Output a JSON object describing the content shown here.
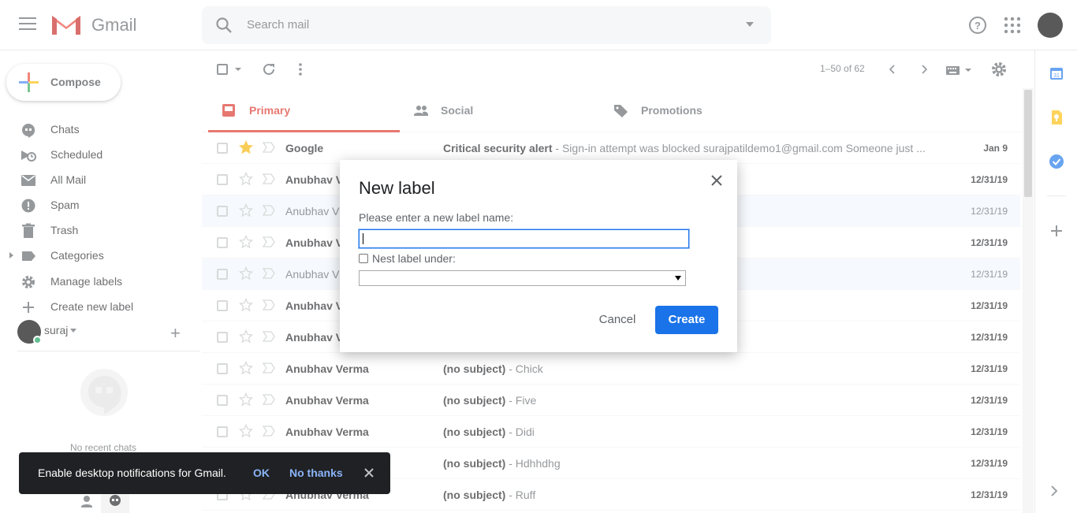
{
  "app": {
    "name": "Gmail"
  },
  "search": {
    "placeholder": "Search mail"
  },
  "compose": {
    "label": "Compose"
  },
  "nav": [
    {
      "label": "Chats",
      "icon": "chat-icon"
    },
    {
      "label": "Scheduled",
      "icon": "scheduled-icon"
    },
    {
      "label": "All Mail",
      "icon": "all-mail-icon"
    },
    {
      "label": "Spam",
      "icon": "spam-icon"
    },
    {
      "label": "Trash",
      "icon": "trash-icon"
    },
    {
      "label": "Categories",
      "icon": "label-icon"
    },
    {
      "label": "Manage labels",
      "icon": "gear-icon"
    },
    {
      "label": "Create new label",
      "icon": "plus-icon"
    }
  ],
  "hangouts": {
    "user": "suraj",
    "empty_text": "No recent chats"
  },
  "toolbar": {
    "range": "1–50 of 62"
  },
  "tabs": [
    {
      "label": "Primary",
      "active": true
    },
    {
      "label": "Social",
      "active": false
    },
    {
      "label": "Promotions",
      "active": false
    }
  ],
  "emails": [
    {
      "sender": "Google",
      "subject": "Critical security alert",
      "snippet": " - Sign-in attempt was blocked surajpatildemo1@gmail.com Someone just ...",
      "date": "Jan 9",
      "unread": true,
      "starred": true
    },
    {
      "sender": "Anubhav V",
      "subject": "",
      "snippet": "",
      "date": "12/31/19",
      "unread": true,
      "starred": false
    },
    {
      "sender": "Anubhav V",
      "subject": "",
      "snippet": "",
      "date": "12/31/19",
      "unread": false,
      "starred": false
    },
    {
      "sender": "Anubhav V",
      "subject": "",
      "snippet": "",
      "date": "12/31/19",
      "unread": true,
      "starred": false
    },
    {
      "sender": "Anubhav V",
      "subject": "",
      "snippet": "",
      "date": "12/31/19",
      "unread": false,
      "starred": false
    },
    {
      "sender": "Anubhav V",
      "subject": "",
      "snippet": "",
      "date": "12/31/19",
      "unread": true,
      "starred": false
    },
    {
      "sender": "Anubhav V",
      "subject": "",
      "snippet": "",
      "date": "12/31/19",
      "unread": true,
      "starred": false
    },
    {
      "sender": "Anubhav Verma",
      "subject": "(no subject)",
      "snippet": " - Chick",
      "date": "12/31/19",
      "unread": true,
      "starred": false
    },
    {
      "sender": "Anubhav Verma",
      "subject": "(no subject)",
      "snippet": " - Five",
      "date": "12/31/19",
      "unread": true,
      "starred": false
    },
    {
      "sender": "Anubhav Verma",
      "subject": "(no subject)",
      "snippet": " - Didi",
      "date": "12/31/19",
      "unread": true,
      "starred": false
    },
    {
      "sender": "Anubhav Verma",
      "subject": "(no subject)",
      "snippet": " - Hdhhdhg",
      "date": "12/31/19",
      "unread": true,
      "starred": false
    },
    {
      "sender": "Anubhav Verma",
      "subject": "(no subject)",
      "snippet": " - Ruff",
      "date": "12/31/19",
      "unread": true,
      "starred": false
    }
  ],
  "dialog": {
    "title": "New label",
    "prompt": "Please enter a new label name:",
    "input_value": "",
    "nest_label": "Nest label under:",
    "nest_checked": false,
    "nest_selected": "",
    "cancel": "Cancel",
    "create": "Create"
  },
  "snackbar": {
    "text": "Enable desktop notifications for Gmail.",
    "ok": "OK",
    "no_thanks": "No thanks"
  },
  "colors": {
    "accent": "#d93025",
    "primary_button": "#1a73e8",
    "snackbar": "#202124"
  }
}
